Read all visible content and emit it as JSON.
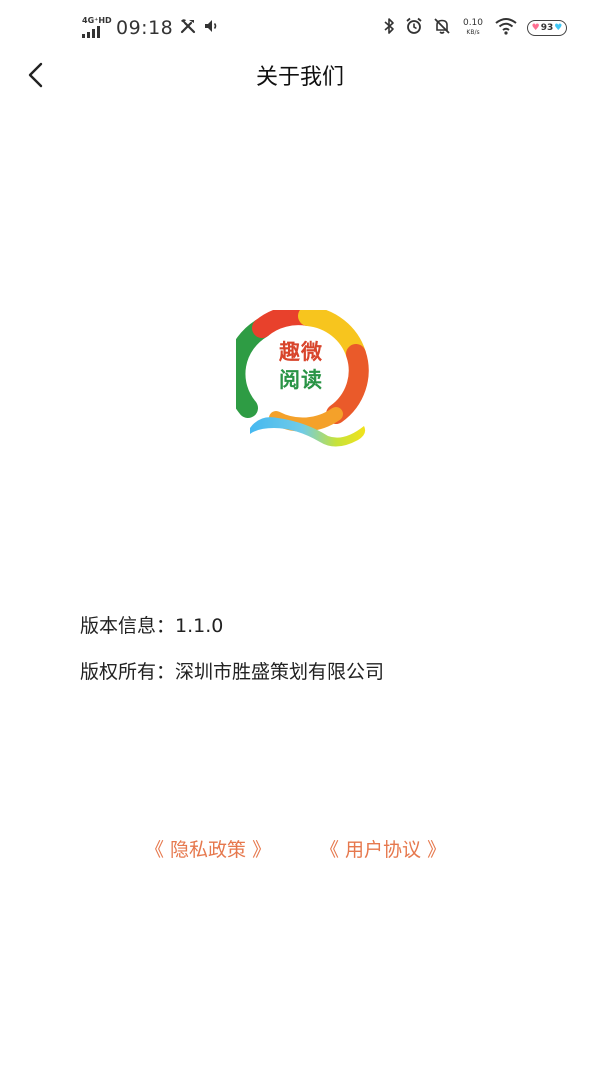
{
  "status_bar": {
    "network_type": "4G⁺HD",
    "time": "09:18",
    "net_speed_value": "0.10",
    "net_speed_unit": "KB/s",
    "battery_level": "93",
    "icons": [
      "signal-icon",
      "tools-icon",
      "volume-icon",
      "bluetooth-icon",
      "alarm-icon",
      "notifications-off-icon",
      "wifi-icon",
      "battery-icon"
    ]
  },
  "header": {
    "back_icon": "chevron-left-icon",
    "title": "关于我们"
  },
  "logo": {
    "line1": "趣微",
    "line2": "阅读",
    "colors": [
      "#e8412c",
      "#f7d21e",
      "#2e9c44",
      "#45b8f0",
      "#d8452c",
      "#2a9446"
    ]
  },
  "info": {
    "version_text": "版本信息：1.1.0",
    "copyright_text": "版权所有：深圳市胜盛策划有限公司"
  },
  "links": {
    "privacy_label": "《 隐私政策 》",
    "agreement_label": "《 用户协议 》",
    "link_color": "#e6784d"
  }
}
